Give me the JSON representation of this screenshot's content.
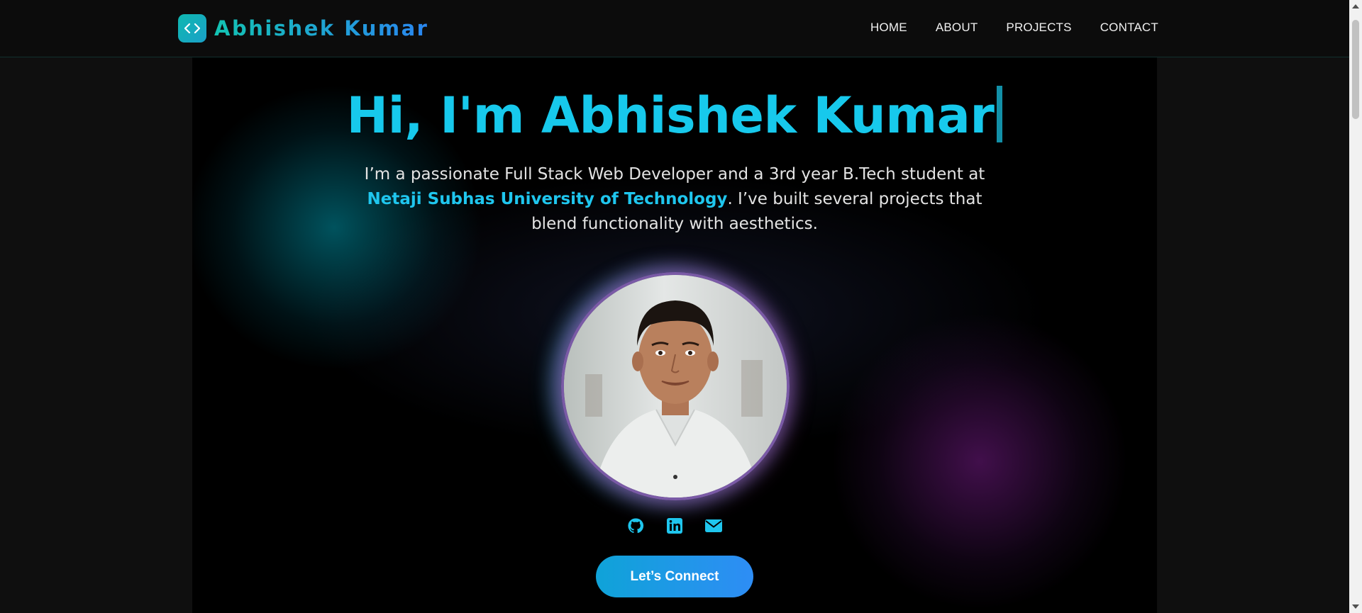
{
  "brand": {
    "name": "Abhishek Kumar",
    "icon": "code-icon"
  },
  "nav": {
    "items": [
      "HOME",
      "ABOUT",
      "PROJECTS",
      "CONTACT"
    ]
  },
  "hero": {
    "title": "Hi, I'm Abhishek Kumar",
    "desc_part1": "I’m a passionate Full Stack Web Developer and a 3rd year B.Tech student at ",
    "desc_highlight": "Netaji Subhas University of Technology",
    "desc_part2": ". I’ve built several projects that blend functionality with aesthetics.",
    "social_icons": [
      "github-icon",
      "linkedin-icon",
      "mail-icon"
    ],
    "cta_label": "Let’s Connect"
  },
  "colors": {
    "accent": "#17c9ec",
    "button_start": "#0fa3d8",
    "button_end": "#2e8df5",
    "glow_teal": "#0096aa",
    "glow_purple": "#821e96"
  }
}
